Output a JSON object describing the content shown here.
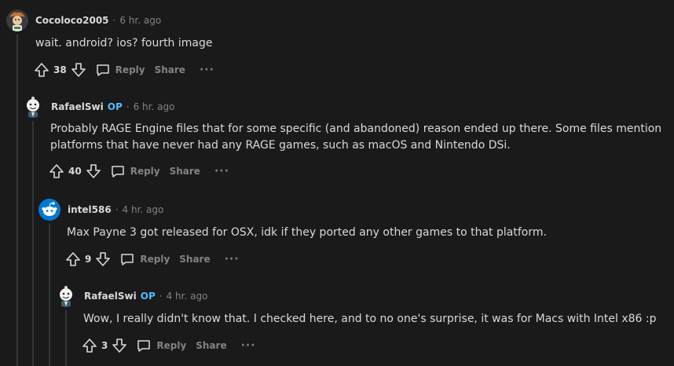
{
  "comments": [
    {
      "username": "Cocoloco2005",
      "op": "",
      "time": "6 hr. ago",
      "text": "wait. android? ios? fourth image",
      "score": "38",
      "reply_label": "Reply",
      "share_label": "Share",
      "more_label": "···"
    },
    {
      "username": "RafaelSwi",
      "op": "OP",
      "time": "6 hr. ago",
      "text_line1": "Probably RAGE Engine files that for some specific (and abandoned) reason ended up there. Some files mention",
      "text_line2": "platforms that have never had any RAGE games, such as macOS and Nintendo DSi.",
      "score": "40",
      "reply_label": "Reply",
      "share_label": "Share",
      "more_label": "···"
    },
    {
      "username": "intel586",
      "op": "",
      "time": "4 hr. ago",
      "text": "Max Payne 3 got released for OSX, idk if they ported any other games to that platform.",
      "score": "9",
      "reply_label": "Reply",
      "share_label": "Share",
      "more_label": "···"
    },
    {
      "username": "RafaelSwi",
      "op": "OP",
      "time": "4 hr. ago",
      "text": "Wow, I really didn't know that. I checked here, and to no one's surprise, it was for Macs with Intel x86 :p",
      "score": "3",
      "reply_label": "Reply",
      "share_label": "Share",
      "more_label": "···"
    }
  ],
  "separator": "·",
  "colors": {
    "background": "#1a1a1b",
    "text": "#d7dadc",
    "muted": "#818384",
    "op": "#4fbcff",
    "thread_line": "#343536"
  }
}
